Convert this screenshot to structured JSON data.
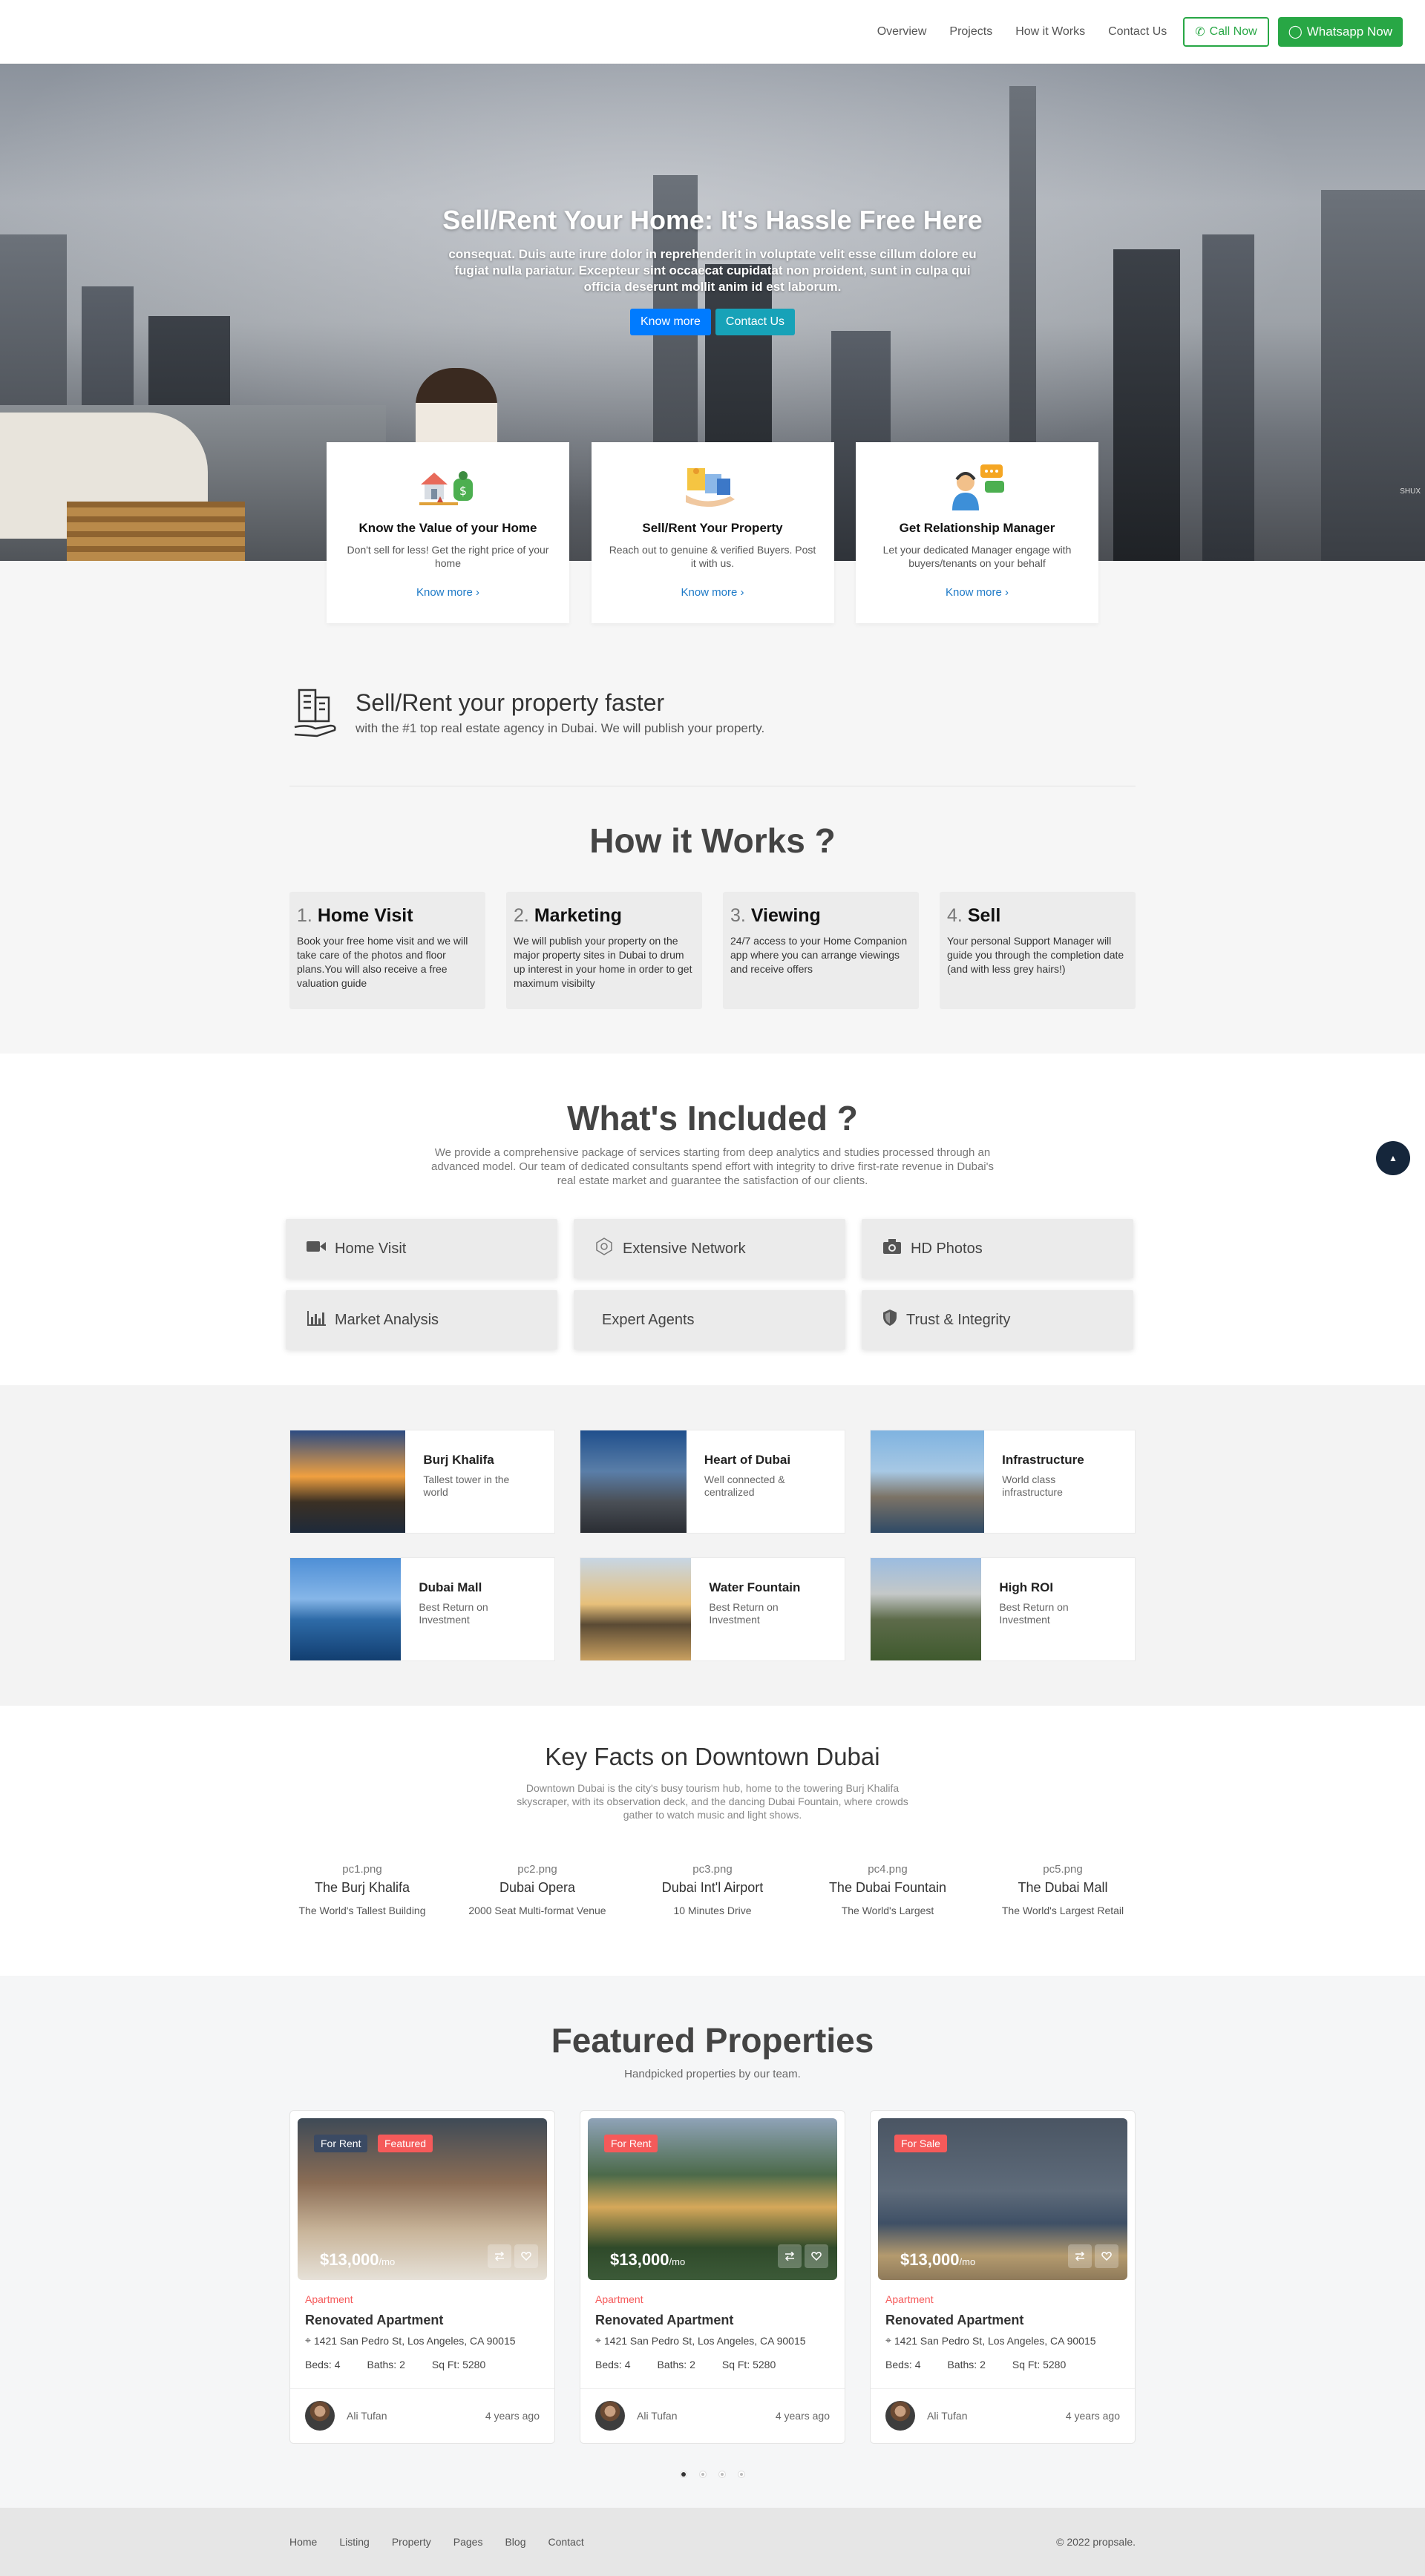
{
  "nav": {
    "links": [
      "Overview",
      "Projects",
      "How it Works",
      "Contact Us"
    ],
    "call": "Call Now",
    "whatsapp": "Whatsapp Now"
  },
  "hero": {
    "title": "Sell/Rent Your Home: It's Hassle Free Here",
    "text": "consequat. Duis aute irure dolor in reprehenderit in voluptate velit esse cillum dolore eu fugiat nulla pariatur. Excepteur sint occaecat cupidatat non proident, sunt in culpa qui officia deserunt mollit anim id est laborum.",
    "btn_know": "Know more",
    "btn_contact": "Contact Us",
    "watermark": "SHUX"
  },
  "feature_cards": [
    {
      "title": "Know the Value of your Home",
      "text": "Don't sell for less! Get the right price of your home",
      "link": "Know more ›"
    },
    {
      "title": "Sell/Rent Your Property",
      "text": "Reach out to genuine & verified Buyers. Post it with us.",
      "link": "Know more ›"
    },
    {
      "title": "Get Relationship Manager",
      "text": "Let your dedicated Manager engage with buyers/tenants on your behalf",
      "link": "Know more ›"
    }
  ],
  "faster": {
    "title": "Sell/Rent your property faster",
    "text": "with the #1 top real estate agency in Dubai. We will publish your property."
  },
  "how": {
    "title": "How it Works ?",
    "steps": [
      {
        "num": "1.",
        "title": "Home Visit",
        "text": "Book your free home visit and we will take care of the photos and floor plans.You will also receive a free valuation guide"
      },
      {
        "num": "2.",
        "title": "Marketing",
        "text": "We will publish your property on the major property sites in Dubai to drum up interest in your home in order to get maximum visibilty"
      },
      {
        "num": "3.",
        "title": "Viewing",
        "text": "24/7 access to your Home Companion app where you can arrange viewings and receive offers"
      },
      {
        "num": "4.",
        "title": "Sell",
        "text": "Your personal Support Manager will guide you through the completion date (and with less grey hairs!)"
      }
    ]
  },
  "included": {
    "title": "What's Included ?",
    "text": "We provide a comprehensive package of services starting from deep analytics and studies processed through an advanced model. Our team of dedicated consultants spend effort with integrity to drive first-rate revenue in Dubai's real estate market and guarantee the satisfaction of our clients.",
    "items": [
      {
        "label": "Home Visit",
        "icon": "video-camera-icon"
      },
      {
        "label": "Extensive Network",
        "icon": "network-icon"
      },
      {
        "label": "HD Photos",
        "icon": "camera-icon"
      },
      {
        "label": "Market Analysis",
        "icon": "bar-chart-icon"
      },
      {
        "label": "Expert Agents",
        "icon": "none"
      },
      {
        "label": "Trust & Integrity",
        "icon": "shield-icon"
      }
    ]
  },
  "locations": [
    {
      "title": "Burj Khalifa",
      "text": "Tallest tower in the world"
    },
    {
      "title": "Heart of Dubai",
      "text": "Well connected & centralized"
    },
    {
      "title": "Infrastructure",
      "text": "World class infrastructure"
    },
    {
      "title": "Dubai Mall",
      "text": "Best Return on Investment"
    },
    {
      "title": "Water Fountain",
      "text": "Best Return on Investment"
    },
    {
      "title": "High ROI",
      "text": "Best Return on Investment"
    }
  ],
  "facts": {
    "title": "Key Facts on Downtown Dubai",
    "text": "Downtown Dubai is the city's busy tourism hub, home to the towering Burj Khalifa skyscraper, with its observation deck, and the dancing Dubai Fountain, where crowds gather to watch music and light shows.",
    "items": [
      {
        "file": "pc1.png",
        "title": "The Burj Khalifa",
        "desc": "The World's Tallest Building"
      },
      {
        "file": "pc2.png",
        "title": "Dubai Opera",
        "desc": "2000 Seat Multi-format Venue"
      },
      {
        "file": "pc3.png",
        "title": "Dubai Int'l Airport",
        "desc": "10 Minutes Drive"
      },
      {
        "file": "pc4.png",
        "title": "The Dubai Fountain",
        "desc": "The World's Largest"
      },
      {
        "file": "pc5.png",
        "title": "The Dubai Mall",
        "desc": "The World's Largest Retail"
      }
    ]
  },
  "featured": {
    "title": "Featured Properties",
    "subtitle": "Handpicked properties by our team.",
    "cards": [
      {
        "tag1": "For Rent",
        "tag2": "Featured",
        "price": "$13,000",
        "per": "/mo",
        "type": "Apartment",
        "title": "Renovated Apartment",
        "address": "1421 San Pedro St, Los Angeles, CA 90015",
        "beds": "Beds: 4",
        "baths": "Baths: 2",
        "sqft": "Sq Ft: 5280",
        "author": "Ali Tufan",
        "time": "4 years ago"
      },
      {
        "tag1": "For Rent",
        "tag2": "",
        "price": "$13,000",
        "per": "/mo",
        "type": "Apartment",
        "title": "Renovated Apartment",
        "address": "1421 San Pedro St, Los Angeles, CA 90015",
        "beds": "Beds: 4",
        "baths": "Baths: 2",
        "sqft": "Sq Ft: 5280",
        "author": "Ali Tufan",
        "time": "4 years ago"
      },
      {
        "tag1": "For Sale",
        "tag2": "",
        "price": "$13,000",
        "per": "/mo",
        "type": "Apartment",
        "title": "Renovated Apartment",
        "address": "1421 San Pedro St, Los Angeles, CA 90015",
        "beds": "Beds: 4",
        "baths": "Baths: 2",
        "sqft": "Sq Ft: 5280",
        "author": "Ali Tufan",
        "time": "4 years ago"
      }
    ]
  },
  "footer": {
    "links": [
      "Home",
      "Listing",
      "Property",
      "Pages",
      "Blog",
      "Contact"
    ],
    "copyright": "© 2022 propsale."
  },
  "colors": {
    "primary": "#007bff",
    "success": "#28a745",
    "teal": "#17a2b8",
    "accent_red": "#f55a5a",
    "dark_navy": "#15263b"
  }
}
